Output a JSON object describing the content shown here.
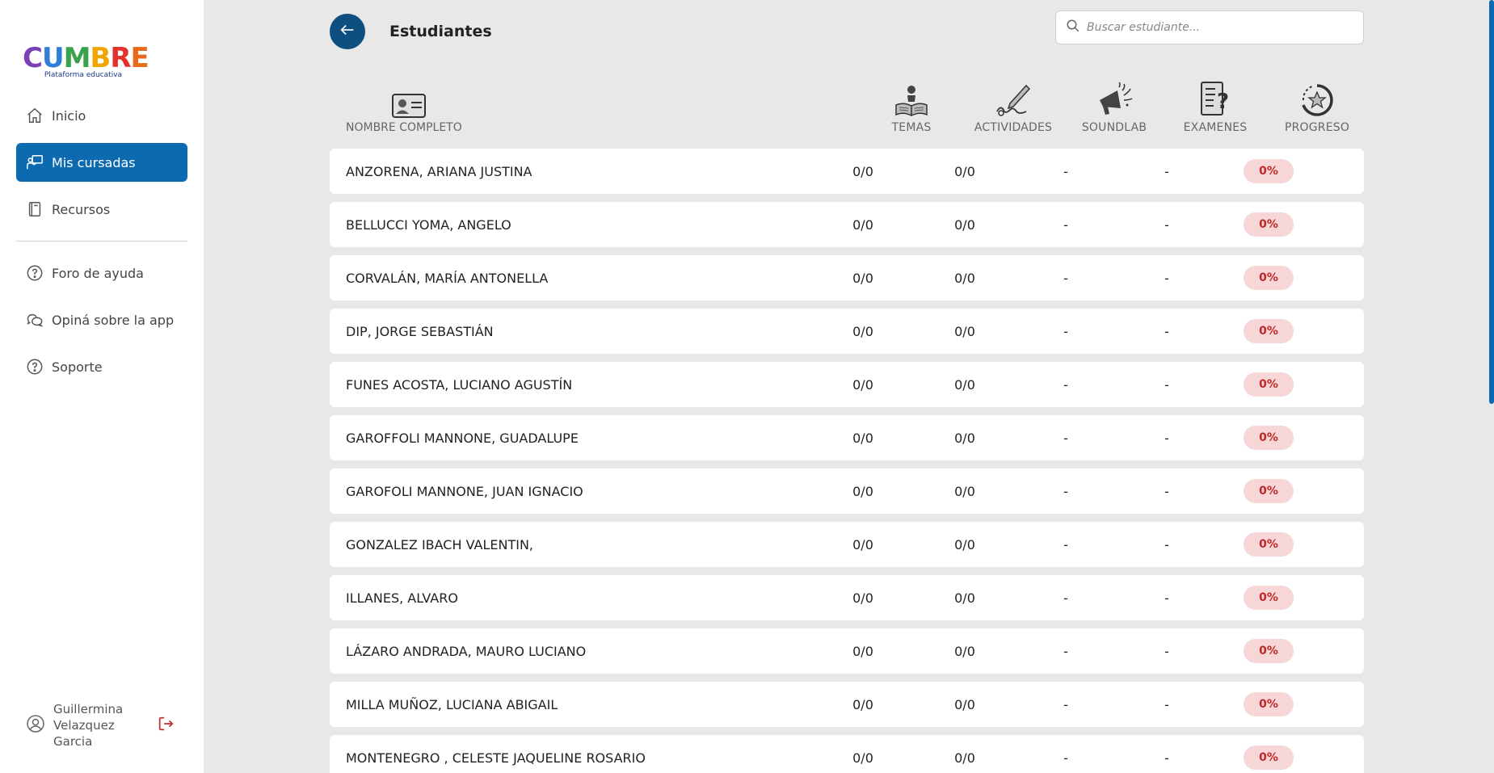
{
  "logo": {
    "letters": [
      {
        "char": "C",
        "color": "#7b3fb6"
      },
      {
        "char": "U",
        "color": "#2e7dd6"
      },
      {
        "char": "M",
        "color": "#3aa24a"
      },
      {
        "char": "B",
        "color": "#f0a500"
      },
      {
        "char": "R",
        "color": "#e2322b"
      },
      {
        "char": "E",
        "color": "#e86a1c"
      }
    ],
    "subtitle": "Plataforma educativa"
  },
  "sidebar": {
    "items": [
      {
        "label": "Inicio",
        "icon": "home-icon"
      },
      {
        "label": "Mis cursadas",
        "icon": "teacher-board-icon",
        "active": true
      },
      {
        "label": "Recursos",
        "icon": "book-icon"
      },
      {
        "label": "Foro de ayuda",
        "icon": "help-circle-icon"
      },
      {
        "label": "Opiná sobre la app",
        "icon": "chat-bubbles-icon"
      },
      {
        "label": "Soporte",
        "icon": "help-circle-icon"
      }
    ],
    "user": {
      "name": "Guillermina Velazquez Garcia",
      "icon": "user-circle-icon"
    },
    "logout_icon": "logout-icon"
  },
  "header": {
    "title": "Estudiantes",
    "back_icon": "arrow-left-icon"
  },
  "search": {
    "placeholder": "Buscar estudiante...",
    "value": ""
  },
  "table": {
    "columns": {
      "name": "NOMBRE COMPLETO",
      "temas": "TEMAS",
      "actividades": "ACTIVIDADES",
      "soundlab": "SOUNDLAB",
      "examenes": "EXAMENES",
      "progreso": "PROGRESO"
    },
    "rows": [
      {
        "name": "ANZORENA, ARIANA JUSTINA",
        "temas": "0/0",
        "actividades": "0/0",
        "soundlab": "-",
        "examenes": "-",
        "progreso": "0%"
      },
      {
        "name": "BELLUCCI YOMA, ANGELO",
        "temas": "0/0",
        "actividades": "0/0",
        "soundlab": "-",
        "examenes": "-",
        "progreso": "0%"
      },
      {
        "name": "CORVALÁN, MARÍA ANTONELLA",
        "temas": "0/0",
        "actividades": "0/0",
        "soundlab": "-",
        "examenes": "-",
        "progreso": "0%"
      },
      {
        "name": "DIP, JORGE SEBASTIÁN",
        "temas": "0/0",
        "actividades": "0/0",
        "soundlab": "-",
        "examenes": "-",
        "progreso": "0%"
      },
      {
        "name": "FUNES ACOSTA, LUCIANO AGUSTÍN",
        "temas": "0/0",
        "actividades": "0/0",
        "soundlab": "-",
        "examenes": "-",
        "progreso": "0%"
      },
      {
        "name": "GAROFFOLI MANNONE, GUADALUPE",
        "temas": "0/0",
        "actividades": "0/0",
        "soundlab": "-",
        "examenes": "-",
        "progreso": "0%"
      },
      {
        "name": "GAROFOLI MANNONE, JUAN IGNACIO",
        "temas": "0/0",
        "actividades": "0/0",
        "soundlab": "-",
        "examenes": "-",
        "progreso": "0%"
      },
      {
        "name": "GONZALEZ IBACH VALENTIN,",
        "temas": "0/0",
        "actividades": "0/0",
        "soundlab": "-",
        "examenes": "-",
        "progreso": "0%"
      },
      {
        "name": "ILLANES, ALVARO",
        "temas": "0/0",
        "actividades": "0/0",
        "soundlab": "-",
        "examenes": "-",
        "progreso": "0%"
      },
      {
        "name": "LÁZARO ANDRADA, MAURO LUCIANO",
        "temas": "0/0",
        "actividades": "0/0",
        "soundlab": "-",
        "examenes": "-",
        "progreso": "0%"
      },
      {
        "name": "MILLA MUÑOZ, LUCIANA ABIGAIL",
        "temas": "0/0",
        "actividades": "0/0",
        "soundlab": "-",
        "examenes": "-",
        "progreso": "0%"
      },
      {
        "name": "MONTENEGRO , CELESTE JAQUELINE ROSARIO",
        "temas": "0/0",
        "actividades": "0/0",
        "soundlab": "-",
        "examenes": "-",
        "progreso": "0%"
      }
    ]
  },
  "colors": {
    "accent": "#0c6ab0",
    "back_button": "#0e4f82",
    "badge_bg": "#f6d6d6",
    "badge_text": "#c0262a",
    "logout": "#c0262a"
  }
}
